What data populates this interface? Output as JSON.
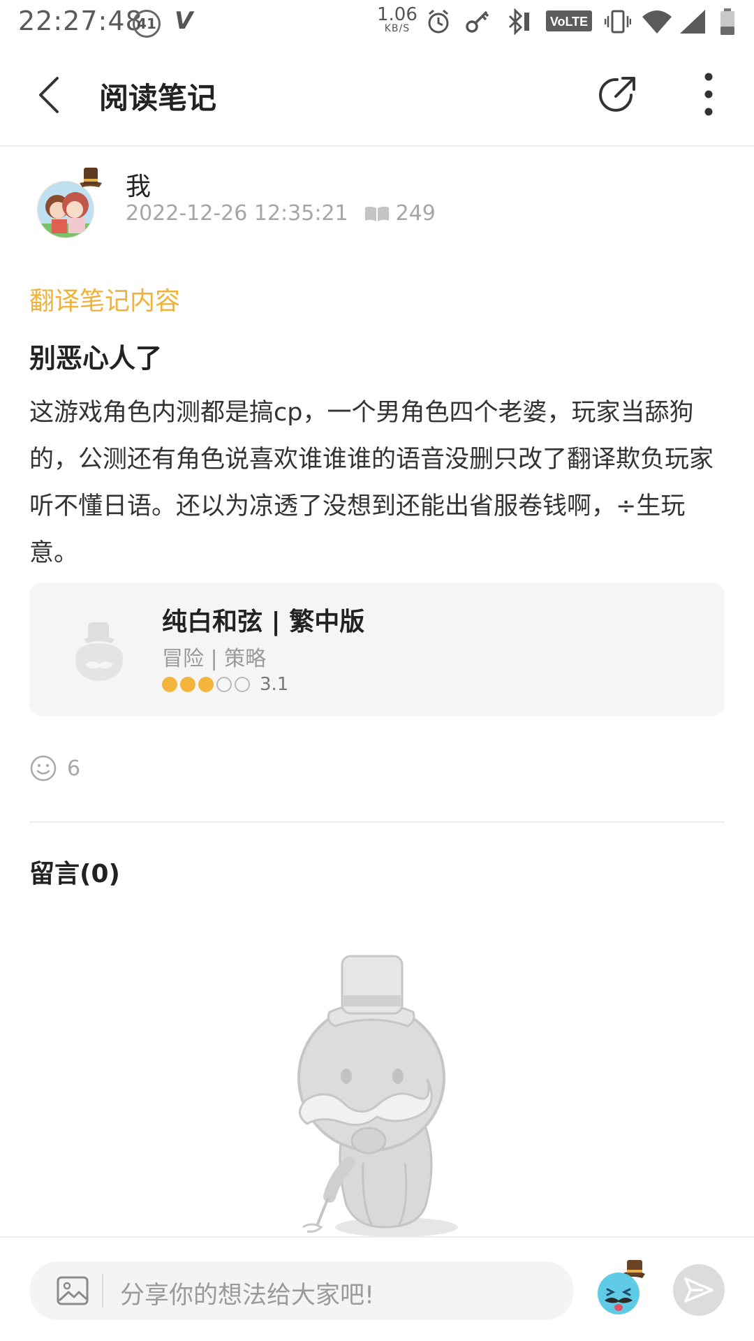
{
  "status_bar": {
    "time": "22:27:48",
    "notification_count": "41",
    "net_speed": "1.06",
    "net_speed_unit": "KB/S",
    "volte": "VoLTE"
  },
  "app_bar": {
    "title": "阅读笔记"
  },
  "author": {
    "name": "我",
    "datetime": "2022-12-26 12:35:21",
    "views": "249"
  },
  "post": {
    "section_label": "翻译笔记内容",
    "title": "别恶心人了",
    "body": "这游戏角色内测都是搞cp，一个男角色四个老婆，玩家当舔狗的，公测还有角色说喜欢谁谁谁的语音没删只改了翻译欺负玩家听不懂日语。还以为凉透了没想到还能出省服卷钱啊，÷生玩意。"
  },
  "game": {
    "name": "纯白和弦 | 繁中版",
    "tags": "冒险 | 策略",
    "rating": 3.1,
    "rating_text": "3.1",
    "rating_max": 5
  },
  "reactions": {
    "like_count": "6"
  },
  "comments": {
    "title": "留言(0)"
  },
  "composer": {
    "placeholder": "分享你的想法给大家吧!"
  },
  "colors": {
    "accent": "#f0b23a",
    "muted_text": "#a6a6a6",
    "card_bg": "#f5f5f5"
  }
}
